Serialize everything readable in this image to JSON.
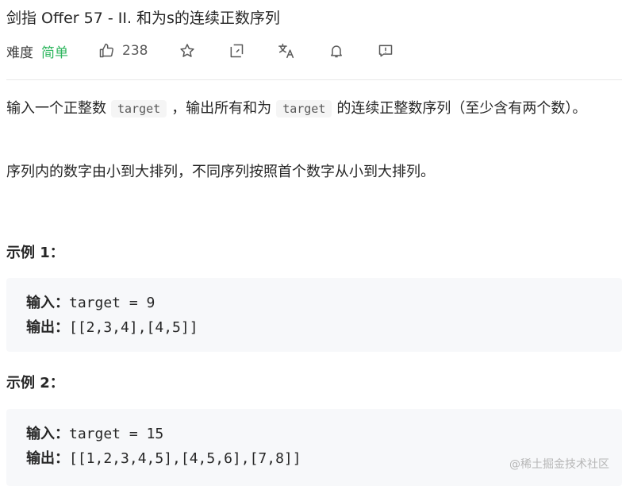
{
  "problem": {
    "title": "剑指 Offer 57 - II. 和为s的连续正数序列",
    "difficulty_label": "难度",
    "difficulty_value": "简单",
    "difficulty_color": "#2db55d",
    "like_count": "238"
  },
  "actions": {
    "icons": [
      "thumbs-up-icon",
      "star-icon",
      "share-icon",
      "translate-icon",
      "bell-icon",
      "feedback-icon"
    ]
  },
  "description": {
    "p1_part1": "输入一个正整数",
    "p1_code1": "target",
    "p1_part2": "，输出所有和为",
    "p1_code2": "target",
    "p1_part3": "的连续正整数序列（至少含有两个数）。",
    "p2": "序列内的数字由小到大排列，不同序列按照首个数字从小到大排列。"
  },
  "examples": [
    {
      "title": "示例 1：",
      "input_label": "输入：",
      "input_value": "target = 9",
      "output_label": "输出：",
      "output_value": "[[2,3,4],[4,5]]"
    },
    {
      "title": "示例 2：",
      "input_label": "输入：",
      "input_value": "target = 15",
      "output_label": "输出：",
      "output_value": "[[1,2,3,4,5],[4,5,6],[7,8]]"
    }
  ],
  "watermark": "@稀土掘金技术社区"
}
